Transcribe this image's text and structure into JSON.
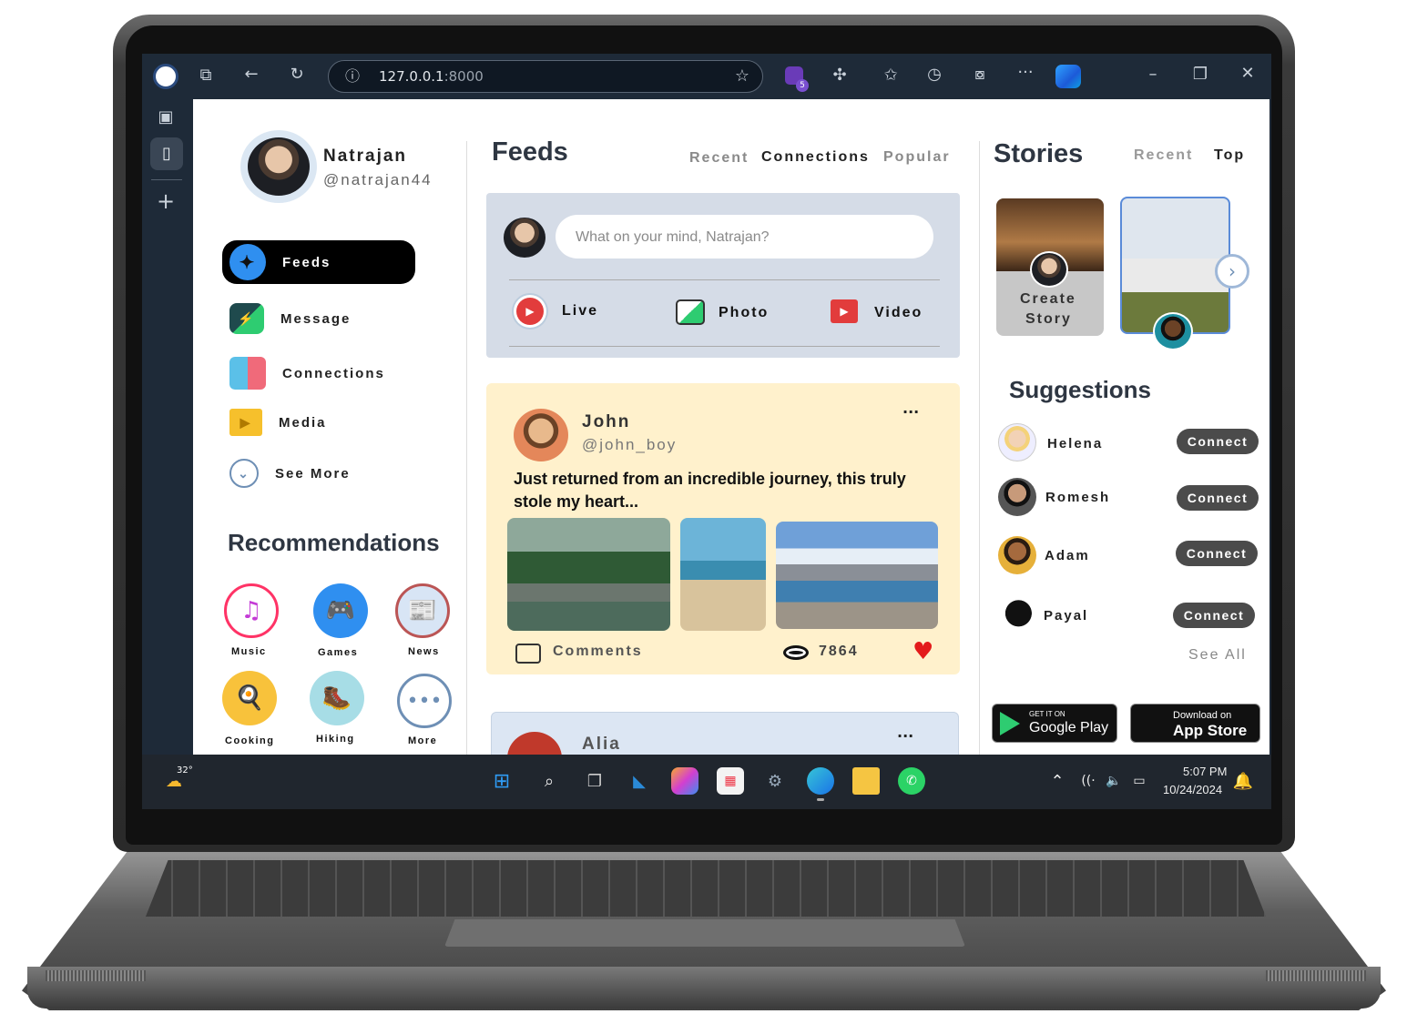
{
  "browser": {
    "url_host": "127.0.0.1",
    "url_port": ":8000"
  },
  "sidebar": {
    "profile_name": "Natrajan",
    "profile_handle": "@natrajan44",
    "nav": [
      {
        "label": "Feeds"
      },
      {
        "label": "Message"
      },
      {
        "label": "Connections"
      },
      {
        "label": "Media"
      },
      {
        "label": "See More"
      }
    ],
    "recommendations_title": "Recommendations",
    "recommendations": [
      {
        "label": "Music",
        "icon": "music-icon"
      },
      {
        "label": "Games",
        "icon": "gamepad-icon"
      },
      {
        "label": "News",
        "icon": "news-icon"
      },
      {
        "label": "Cooking",
        "icon": "cooking-icon"
      },
      {
        "label": "Hiking",
        "icon": "hiking-icon"
      },
      {
        "label": "More",
        "icon": "more-icon"
      }
    ]
  },
  "feeds": {
    "title": "Feeds",
    "tabs": [
      "Recent",
      "Connections",
      "Popular"
    ],
    "composer_placeholder": "What on your mind, Natrajan?",
    "actions": [
      "Live",
      "Photo",
      "Video"
    ],
    "posts": [
      {
        "name": "John",
        "handle": "@john_boy",
        "text": "Just returned from an incredible journey, this truly stole my heart...",
        "comments_label": "Comments",
        "views": "7864"
      },
      {
        "name": "Alia"
      }
    ]
  },
  "stories": {
    "title": "Stories",
    "tabs": [
      "Recent",
      "Top"
    ],
    "create_label_1": "Create",
    "create_label_2": "Story"
  },
  "suggestions": {
    "title": "Suggestions",
    "people": [
      {
        "name": "Helena",
        "button": "Connect"
      },
      {
        "name": "Romesh",
        "button": "Connect"
      },
      {
        "name": "Adam",
        "button": "Connect"
      },
      {
        "name": "Payal",
        "button": "Connect"
      }
    ],
    "see_all": "See All"
  },
  "stores": {
    "google_small": "GET IT ON",
    "google_big": "Google Play",
    "apple_small": "Download on",
    "apple_big": "App Store"
  },
  "taskbar": {
    "weather": "32°",
    "time": "5:07 PM",
    "date": "10/24/2024",
    "extension_badge": "5"
  },
  "colors": {
    "composer_bg": "#d5dce7",
    "post_bg": "#fff1cc",
    "post2_bg": "#dce6f3",
    "accent_blue": "#2f8ff0"
  }
}
